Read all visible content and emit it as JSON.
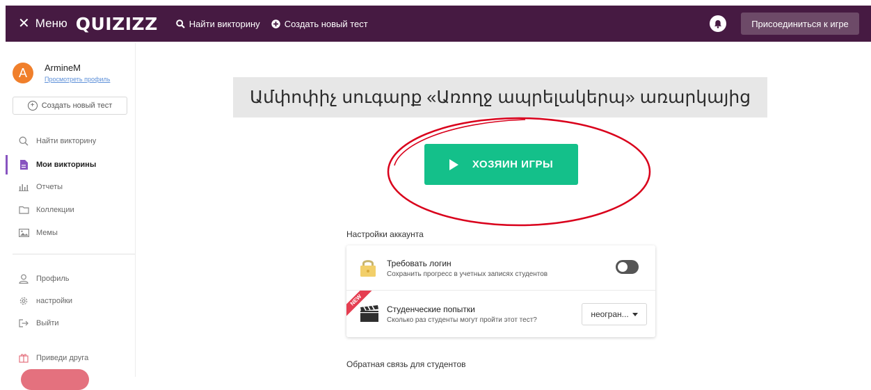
{
  "navbar": {
    "menu_label": "Меню",
    "logo": "QUIZIZZ",
    "find_quiz": "Найти викторину",
    "create_test": "Создать новый тест",
    "join_game": "Присоединиться к игре"
  },
  "sidebar": {
    "avatar_letter": "A",
    "username": "ArmineM",
    "view_profile": "Просмотреть профиль",
    "create_test": "Создать новый тест",
    "items": [
      {
        "label": "Найти викторину",
        "icon": "search-icon"
      },
      {
        "label": "Мои викторины",
        "icon": "document-icon",
        "active": true
      },
      {
        "label": "Отчеты",
        "icon": "bar-chart-icon"
      },
      {
        "label": "Коллекции",
        "icon": "folder-icon"
      },
      {
        "label": "Мемы",
        "icon": "image-icon"
      },
      {
        "label": "Профиль",
        "icon": "user-icon"
      },
      {
        "label": "настройки",
        "icon": "gear-icon"
      },
      {
        "label": "Выйти",
        "icon": "logout-icon"
      },
      {
        "label": "Приведи друга",
        "icon": "gift-icon"
      }
    ]
  },
  "main": {
    "quiz_title": "Ամփոփիչ սուգարք «Առողջ ապրելակերպ» առարկայից",
    "host_button": "ХОЗЯИН ИГРЫ",
    "account_settings_label": "Настройки аккаунта",
    "feedback_label": "Обратная связь для студентов",
    "settings": {
      "require_login_title": "Требовать логин",
      "require_login_sub": "Сохранить прогресс в учетных записях студентов",
      "require_login_on": false,
      "attempts_title": "Студенческие попытки",
      "attempts_sub": "Сколько раз студенты могут пройти этот тест?",
      "attempts_value": "неогран...",
      "new_badge": "NEW"
    }
  },
  "colors": {
    "navbar_bg": "#461a42",
    "host_button": "#14c08a",
    "annotation_circle": "#d9001b",
    "avatar": "#f07f2b"
  }
}
